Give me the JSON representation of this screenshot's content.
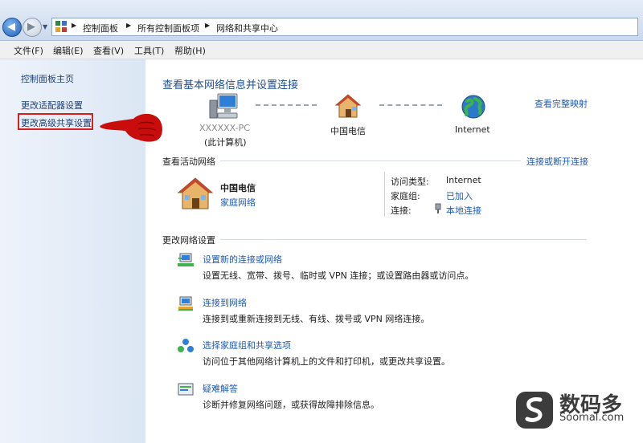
{
  "breadcrumb": [
    "控制面板",
    "所有控制面板项",
    "网络和共享中心"
  ],
  "menu": [
    "文件(F)",
    "编辑(E)",
    "查看(V)",
    "工具(T)",
    "帮助(H)"
  ],
  "sidebar": {
    "home": "控制面板主页",
    "adapter": "更改适配器设置",
    "advanced_sharing": "更改高级共享设置"
  },
  "main": {
    "title": "查看基本网络信息并设置连接",
    "full_map": "查看完整映射",
    "map": {
      "computer_name": "XXXXXX-PC",
      "computer_sub": "(此计算机)",
      "isp": "中国电信",
      "internet": "Internet"
    },
    "active": {
      "title": "查看活动网络",
      "connect_link": "连接或断开连接",
      "name": "中国电信",
      "type": "家庭网络",
      "access_label": "访问类型:",
      "access_value": "Internet",
      "homegroup_label": "家庭组:",
      "homegroup_value": "已加入",
      "conn_label": "连接:",
      "conn_value": "本地连接"
    },
    "change": {
      "title": "更改网络设置",
      "tasks": [
        {
          "title": "设置新的连接或网络",
          "desc": "设置无线、宽带、拨号、临时或 VPN 连接；或设置路由器或访问点。",
          "icon": "new-connection-icon"
        },
        {
          "title": "连接到网络",
          "desc": "连接到或重新连接到无线、有线、拨号或 VPN 网络连接。",
          "icon": "connect-network-icon"
        },
        {
          "title": "选择家庭组和共享选项",
          "desc": "访问位于其他网络计算机上的文件和打印机，或更改共享设置。",
          "icon": "homegroup-icon"
        },
        {
          "title": "疑难解答",
          "desc": "诊断并修复网络问题，或获得故障排除信息。",
          "icon": "troubleshoot-icon"
        }
      ]
    }
  },
  "watermark": {
    "cn": "数码多",
    "en": "Soomal.com"
  }
}
